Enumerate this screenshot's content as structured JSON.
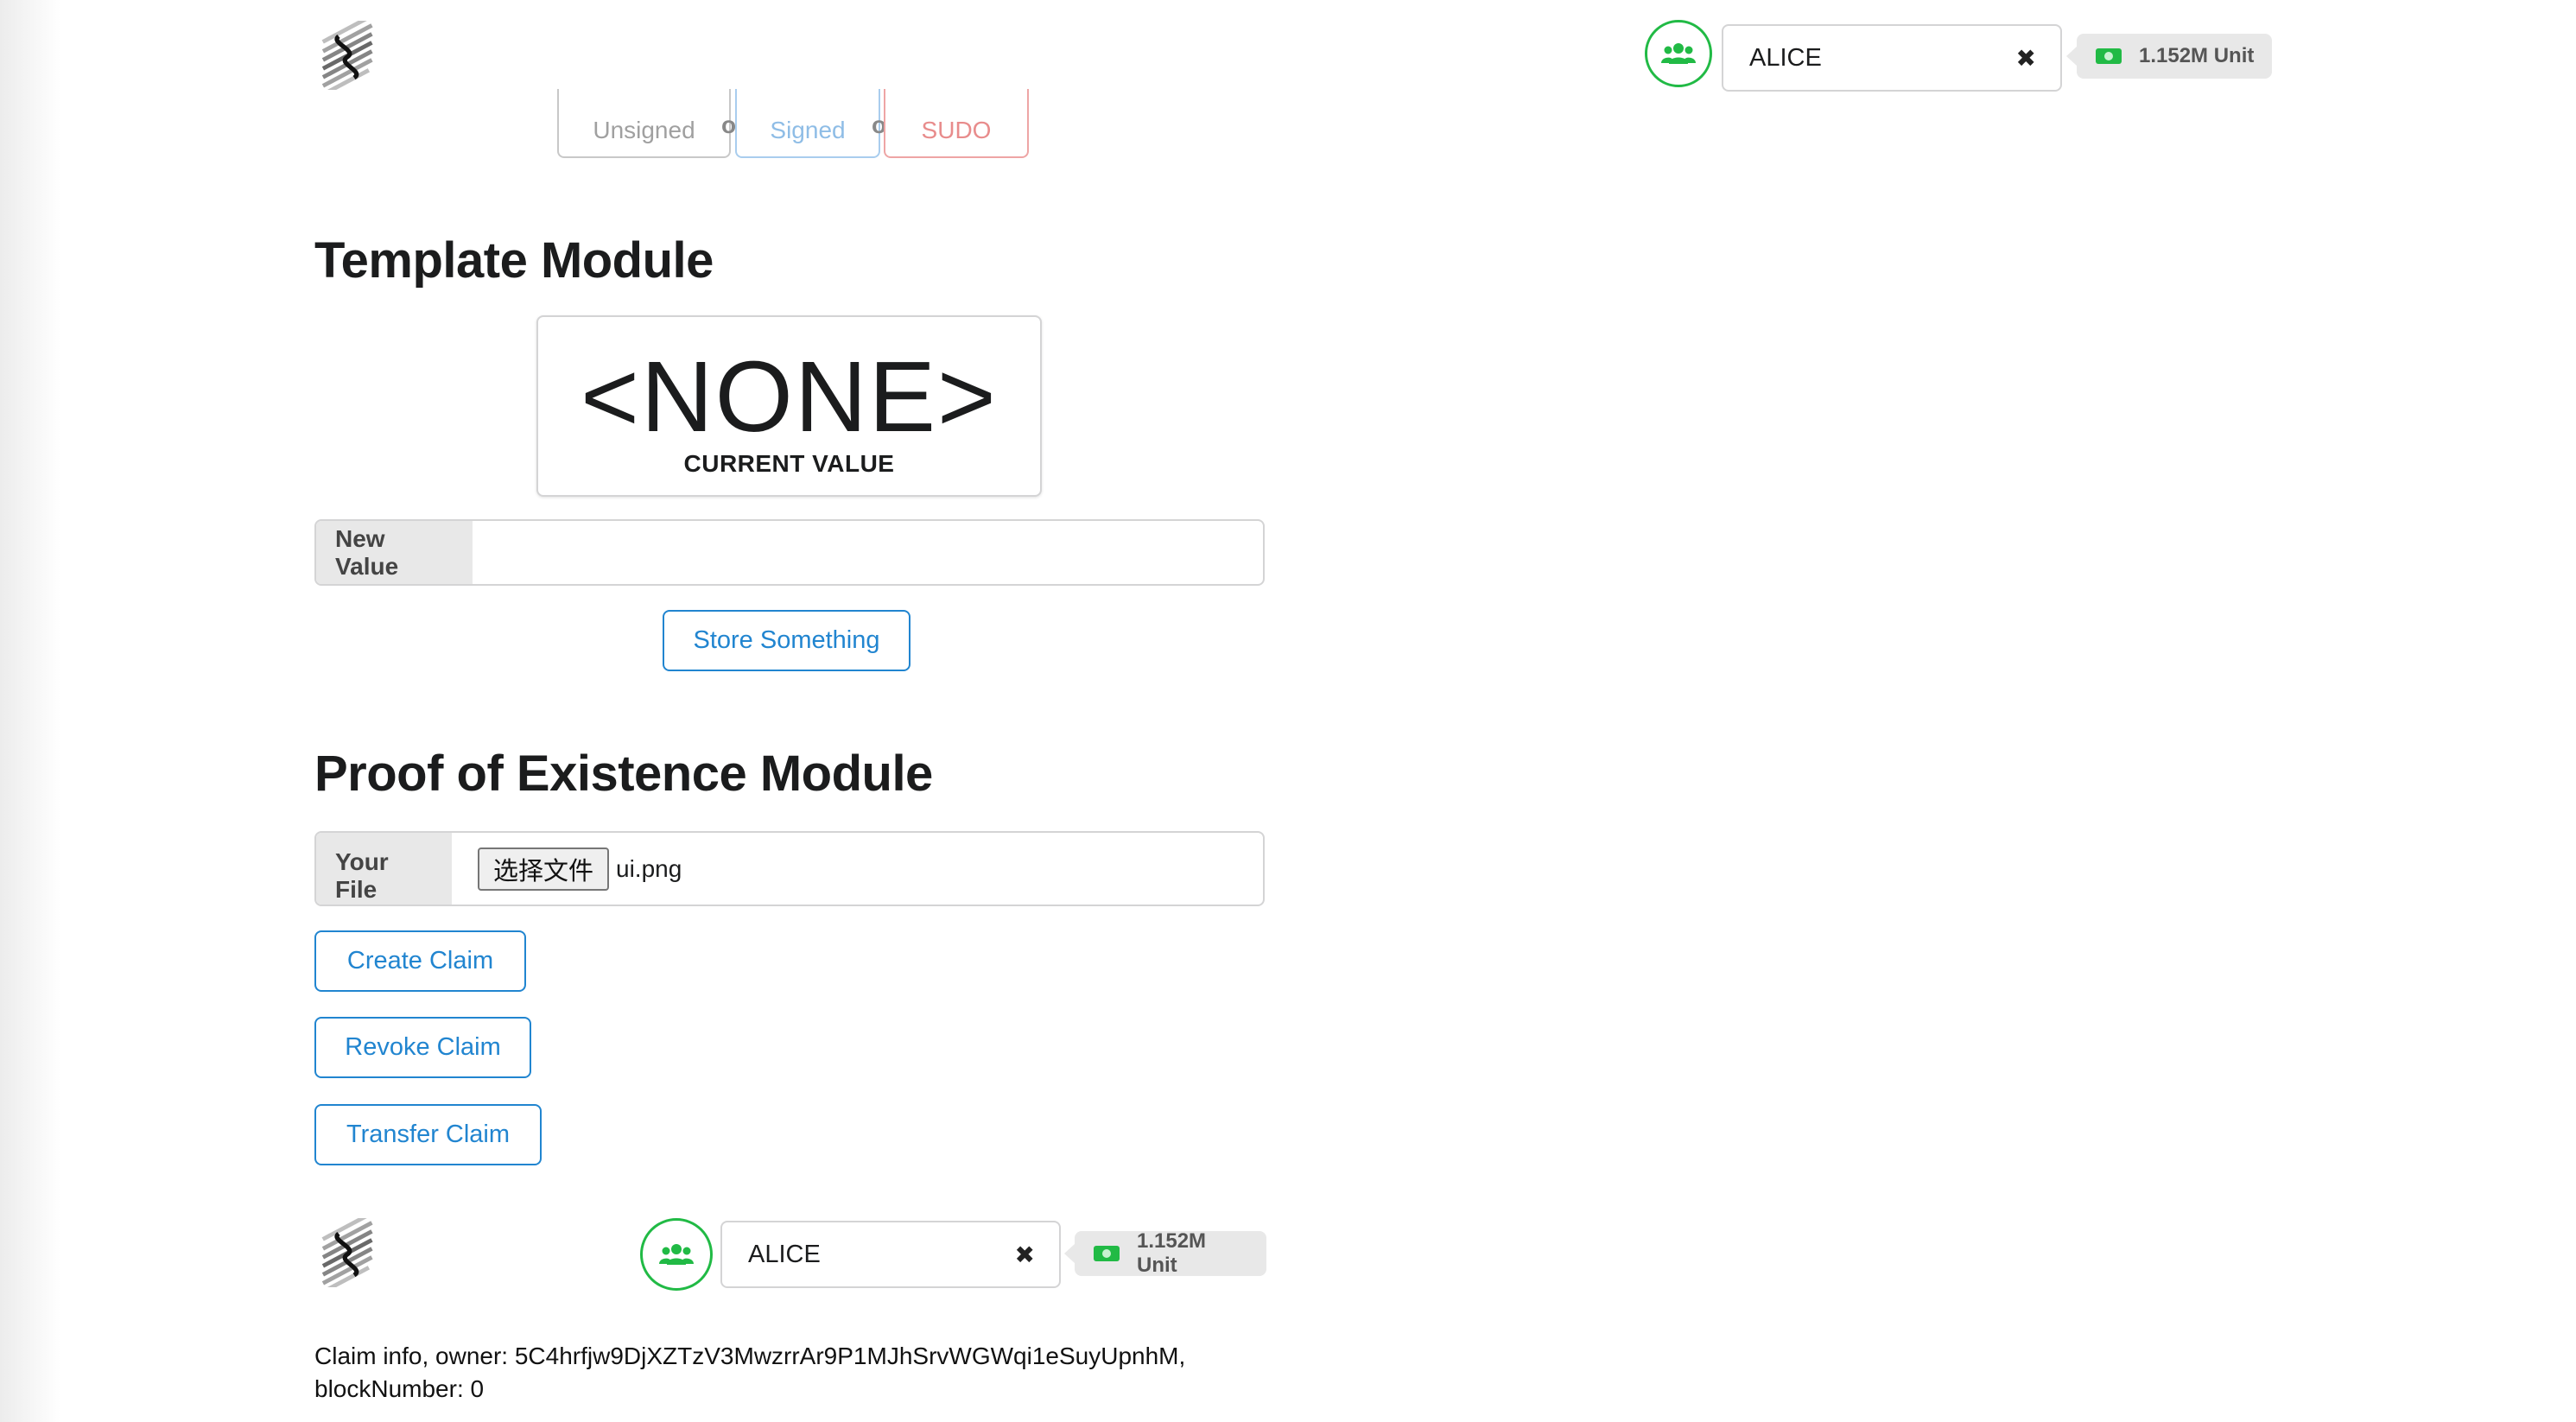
{
  "header": {
    "account_name": "ALICE",
    "clear_icon": "✖",
    "balance": "1.152M Unit"
  },
  "tx_buttons": {
    "unsigned": "Unsigned",
    "or1": "or",
    "signed": "Signed",
    "or2": "or",
    "sudo": "SUDO"
  },
  "template_module": {
    "title": "Template Module",
    "current_value": "<NONE>",
    "current_value_label": "CURRENT VALUE",
    "new_value_label": "New Value",
    "new_value": "",
    "store_button": "Store Something"
  },
  "poe_module": {
    "title": "Proof of Existence Module",
    "file_label": "Your File",
    "file_button": "选择文件",
    "file_name": "ui.png",
    "create_button": "Create Claim",
    "revoke_button": "Revoke Claim",
    "transfer_button": "Transfer Claim"
  },
  "footer_bar": {
    "account_name": "ALICE",
    "clear_icon": "✖",
    "balance": "1.152M Unit"
  },
  "claim_info": {
    "line1": "Claim info, owner: 5C4hrfjw9DjXZTzV3MwzrrAr9P1MJhSrvWGWqi1eSuyUpnhM,",
    "line2": "blockNumber: 0"
  },
  "colors": {
    "primary": "#2185d0",
    "green": "#21ba45",
    "red": "#db2828"
  }
}
